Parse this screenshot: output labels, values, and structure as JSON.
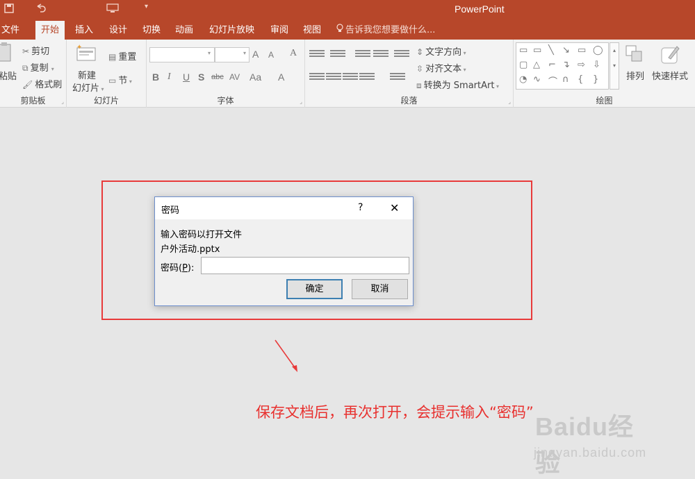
{
  "app": {
    "title": "PowerPoint"
  },
  "quick_access": {
    "icons": [
      "save-icon",
      "undo-icon",
      "present-icon",
      "customize-icon"
    ]
  },
  "tabs": [
    {
      "label": "文件"
    },
    {
      "label": "开始",
      "active": true
    },
    {
      "label": "插入"
    },
    {
      "label": "设计"
    },
    {
      "label": "切换"
    },
    {
      "label": "动画"
    },
    {
      "label": "幻灯片放映"
    },
    {
      "label": "审阅"
    },
    {
      "label": "视图"
    }
  ],
  "tell_me": {
    "text": "告诉我您想要做什么..."
  },
  "ribbon": {
    "clipboard": {
      "label": "剪贴板",
      "paste": "粘贴",
      "cut": "剪切",
      "copy": "复制",
      "format_painter": "格式刷"
    },
    "slides": {
      "label": "幻灯片",
      "new_slide_1": "新建",
      "new_slide_2": "幻灯片",
      "reset": "重置",
      "section": "节"
    },
    "font": {
      "label": "字体",
      "grow": "A",
      "shrink": "A",
      "bold": "B",
      "italic": "I",
      "underline": "U",
      "shadow": "S",
      "strike": "abc",
      "spacing": "AV",
      "case": "Aa",
      "color": "A"
    },
    "paragraph": {
      "label": "段落",
      "text_direction": "文字方向",
      "align_text": "对齐文本",
      "smartart": "转换为 SmartArt"
    },
    "drawing": {
      "label": "绘图",
      "arrange": "排列",
      "quick_styles": "快速样式"
    }
  },
  "dialog": {
    "title": "密码",
    "help": "?",
    "close": "✕",
    "message": "输入密码以打开文件",
    "filename": "户外活动.pptx",
    "password_label_prefix": "密码(",
    "password_label_key": "P",
    "password_label_suffix": "):",
    "password_value": "",
    "ok": "确定",
    "cancel": "取消"
  },
  "annotation": {
    "caption": "保存文档后，再次打开，会提示输入“密码”",
    "color": "#e8302e"
  },
  "watermark": {
    "logo": "Baidu经验",
    "url": "jingyan.baidu.com"
  },
  "colors": {
    "brand": "#b7472a",
    "ribbon_bg": "#f3f3f3",
    "workspace": "#e6e6e6"
  }
}
